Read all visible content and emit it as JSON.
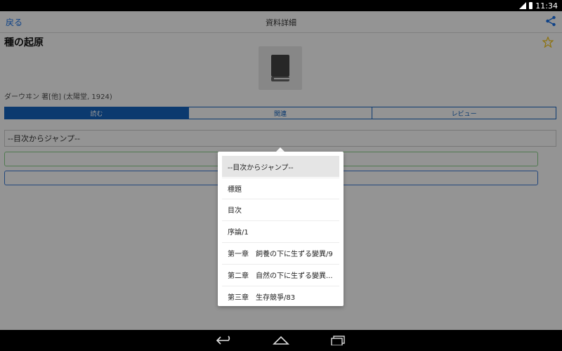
{
  "statusbar": {
    "time": "11:34"
  },
  "actionbar": {
    "back_label": "戻る",
    "title": "資料詳細"
  },
  "book": {
    "title": "種の起原",
    "author_line": "ダーウヰン 著[他] (太陽堂, 1924)"
  },
  "tabs": [
    {
      "label": "読む",
      "active": true
    },
    {
      "label": "関連",
      "active": false
    },
    {
      "label": "レビュー",
      "active": false
    }
  ],
  "jump_select": {
    "value": "--目次からジャンプ--"
  },
  "popup": {
    "items": [
      {
        "label": "--目次からジャンプ--"
      },
      {
        "label": "標題"
      },
      {
        "label": "目次"
      },
      {
        "label": "序論/1"
      },
      {
        "label": "第一章　飼養の下に生ずる變異/9"
      },
      {
        "label": "第二章　自然の下に生ずる變異..."
      },
      {
        "label": "第三章　生存競爭/83"
      }
    ]
  },
  "colors": {
    "accent": "#1565c0",
    "star": "#f5c518"
  },
  "icons": [
    "share-icon",
    "star-icon",
    "book-icon",
    "nav-back-icon",
    "nav-home-icon",
    "nav-recent-icon"
  ]
}
